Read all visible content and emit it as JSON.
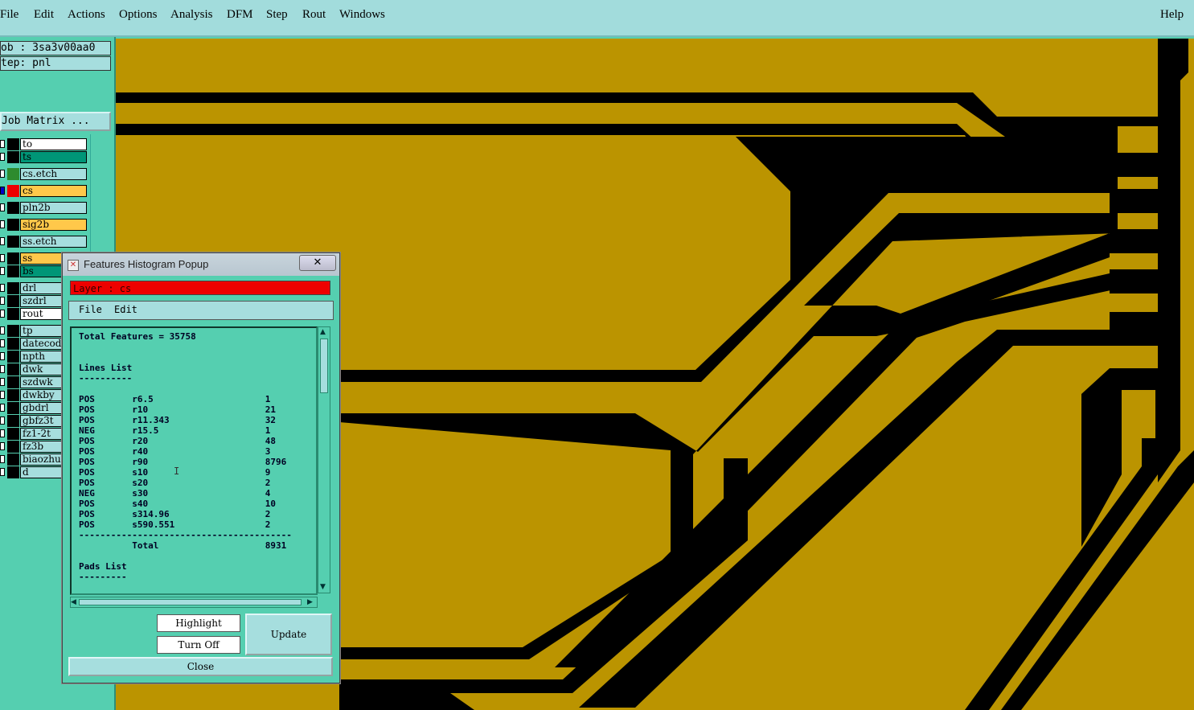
{
  "menubar": {
    "items": [
      "File",
      "Edit",
      "Actions",
      "Options",
      "Analysis",
      "DFM",
      "Step",
      "Rout",
      "Windows"
    ],
    "help": "Help"
  },
  "info": {
    "job": "ob : 3sa3v00aa0",
    "step": "tep: pnl",
    "matrix_button": "Job Matrix ..."
  },
  "layers": [
    {
      "name": "to",
      "bg": "#ffffff",
      "swatch": "#000000"
    },
    {
      "name": "ts",
      "bg": "#009677",
      "swatch": "#000000"
    },
    {
      "name": "cs.etch",
      "bg": "#a6dede",
      "swatch": "#2e8b2e"
    },
    {
      "name": "cs",
      "bg": "#ffc84a",
      "swatch": "#ee0000",
      "chk": "#0000cc"
    },
    {
      "name": "pln2b",
      "bg": "#a6dede",
      "swatch": "#000000"
    },
    {
      "name": "sig2b",
      "bg": "#ffc84a",
      "swatch": "#000000"
    },
    {
      "name": "ss.etch",
      "bg": "#a6dede",
      "swatch": "#000000"
    },
    {
      "name": "ss",
      "bg": "#ffc84a",
      "swatch": "#000000"
    },
    {
      "name": "bs",
      "bg": "#009677",
      "swatch": "#000000"
    },
    {
      "name": "drl",
      "bg": "#a6dede",
      "swatch": "#000000"
    },
    {
      "name": "szdrl",
      "bg": "#a6dede",
      "swatch": "#000000"
    },
    {
      "name": "rout",
      "bg": "#ffffff",
      "swatch": "#000000"
    },
    {
      "name": "tp",
      "bg": "#a6dede",
      "swatch": "#000000"
    },
    {
      "name": "datecod",
      "bg": "#a6dede",
      "swatch": "#000000"
    },
    {
      "name": "npth",
      "bg": "#a6dede",
      "swatch": "#000000"
    },
    {
      "name": "dwk",
      "bg": "#a6dede",
      "swatch": "#000000"
    },
    {
      "name": "szdwk",
      "bg": "#a6dede",
      "swatch": "#000000"
    },
    {
      "name": "dwkby",
      "bg": "#a6dede",
      "swatch": "#000000"
    },
    {
      "name": "gbdrl",
      "bg": "#a6dede",
      "swatch": "#000000"
    },
    {
      "name": "gbfz3t",
      "bg": "#a6dede",
      "swatch": "#000000"
    },
    {
      "name": "fz1-2t",
      "bg": "#a6dede",
      "swatch": "#000000"
    },
    {
      "name": "fz3b",
      "bg": "#a6dede",
      "swatch": "#000000"
    },
    {
      "name": "biaozhu",
      "bg": "#a6dede",
      "swatch": "#000000"
    },
    {
      "name": "d",
      "bg": "#a6dede",
      "swatch": "#000000"
    }
  ],
  "popup": {
    "title": "Features Histogram Popup",
    "close_x": "✕",
    "layer_label": "Layer :  cs",
    "menu": [
      "File",
      "Edit"
    ],
    "lines": [
      "Total Features = 35758",
      "",
      "",
      "Lines List",
      "----------",
      "",
      "POS       r6.5                     1",
      "POS       r10                      21",
      "POS       r11.343                  32",
      "NEG       r15.5                    1",
      "POS       r20                      48",
      "POS       r40                      3",
      "POS       r90                      8796",
      "POS       s10                      9",
      "POS       s20                      2",
      "NEG       s30                      4",
      "POS       s40                      10",
      "POS       s314.96                  2",
      "POS       s590.551                 2",
      "----------------------------------------",
      "          Total                    8931",
      "",
      "Pads List",
      "---------"
    ],
    "buttons": {
      "highlight": "Highlight",
      "turn_off": "Turn Off",
      "update": "Update",
      "close": "Close"
    }
  },
  "colors": {
    "board": "#bb9400",
    "copper": "#000000",
    "panel": "#55cfb0",
    "menubar": "#a2dcdc"
  }
}
